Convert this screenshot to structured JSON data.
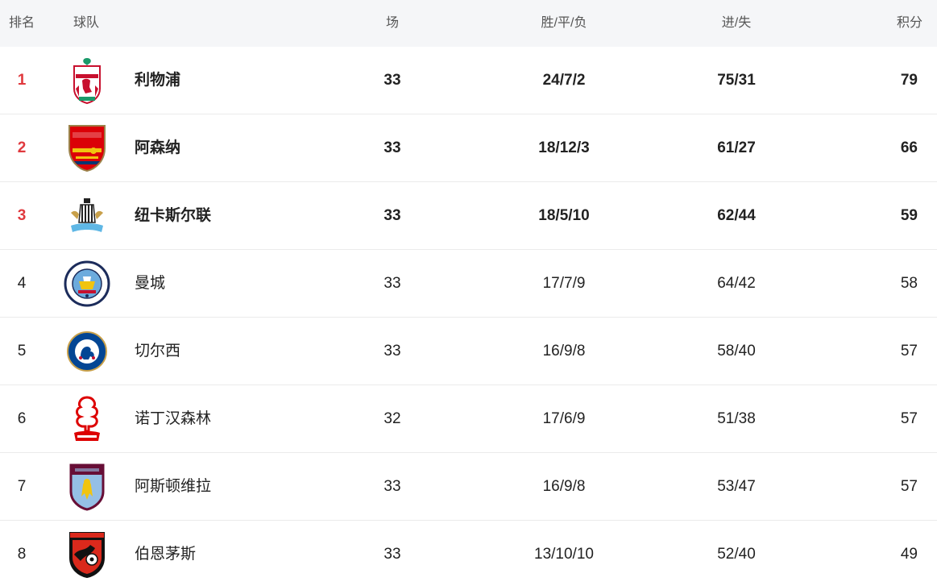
{
  "headers": {
    "rank": "排名",
    "team": "球队",
    "played": "场",
    "wdl": "胜/平/负",
    "goals": "进/失",
    "points": "积分"
  },
  "highlight_color": "#e0393e",
  "rows": [
    {
      "rank": "1",
      "logo": "liverpool-crest-icon",
      "team": "利物浦",
      "played": "33",
      "wdl": "24/7/2",
      "goals": "75/31",
      "points": "79"
    },
    {
      "rank": "2",
      "logo": "arsenal-crest-icon",
      "team": "阿森纳",
      "played": "33",
      "wdl": "18/12/3",
      "goals": "61/27",
      "points": "66"
    },
    {
      "rank": "3",
      "logo": "newcastle-crest-icon",
      "team": "纽卡斯尔联",
      "played": "33",
      "wdl": "18/5/10",
      "goals": "62/44",
      "points": "59"
    },
    {
      "rank": "4",
      "logo": "manchester-city-crest-icon",
      "team": "曼城",
      "played": "33",
      "wdl": "17/7/9",
      "goals": "64/42",
      "points": "58"
    },
    {
      "rank": "5",
      "logo": "chelsea-crest-icon",
      "team": "切尔西",
      "played": "33",
      "wdl": "16/9/8",
      "goals": "58/40",
      "points": "57"
    },
    {
      "rank": "6",
      "logo": "nottingham-forest-crest-icon",
      "team": "诺丁汉森林",
      "played": "32",
      "wdl": "17/6/9",
      "goals": "51/38",
      "points": "57"
    },
    {
      "rank": "7",
      "logo": "aston-villa-crest-icon",
      "team": "阿斯顿维拉",
      "played": "33",
      "wdl": "16/9/8",
      "goals": "53/47",
      "points": "57"
    },
    {
      "rank": "8",
      "logo": "bournemouth-crest-icon",
      "team": "伯恩茅斯",
      "played": "33",
      "wdl": "13/10/10",
      "goals": "52/40",
      "points": "49"
    }
  ]
}
